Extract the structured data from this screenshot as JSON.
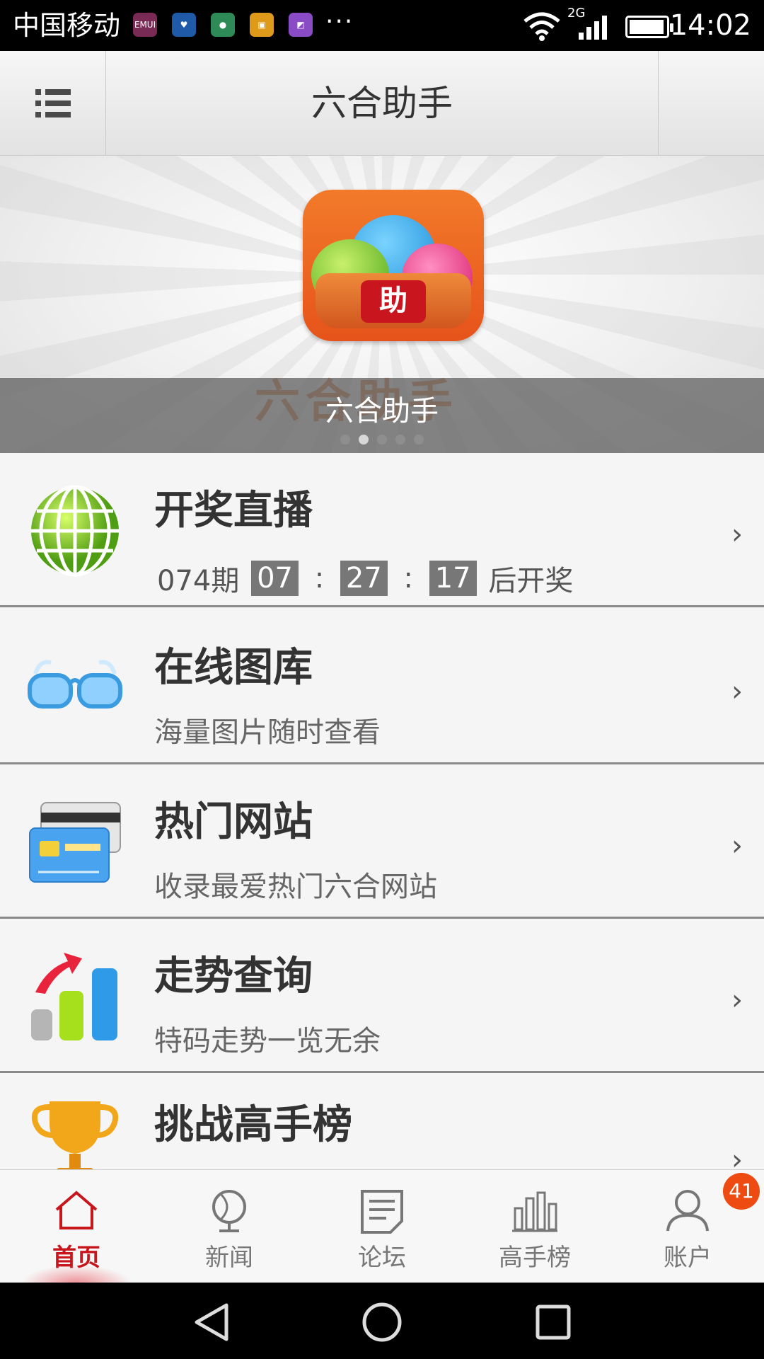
{
  "status_bar": {
    "carrier": "中国移动",
    "notification_icons": [
      "emui-icon",
      "health-icon",
      "message-icon",
      "wallet-icon",
      "gallery-icon"
    ],
    "overflow": "···",
    "network": "2G",
    "time": "14:02"
  },
  "header": {
    "title": "六合助手",
    "menu_icon": "list-menu-icon"
  },
  "banner": {
    "caption": "六合助手",
    "icon_badge": "助",
    "watermark": "六合助手",
    "pages": 5,
    "active_page": 2
  },
  "list": {
    "items": [
      {
        "title": "开奖直播",
        "icon": "globe-icon",
        "countdown": {
          "issue": "074期",
          "hours": "07",
          "minutes": "27",
          "seconds": "17",
          "suffix": "后开奖",
          "sep": ":"
        }
      },
      {
        "title": "在线图库",
        "subtitle": "海量图片随时查看",
        "icon": "glasses-icon"
      },
      {
        "title": "热门网站",
        "subtitle": "收录最爱热门六合网站",
        "icon": "card-icon"
      },
      {
        "title": "走势查询",
        "subtitle": "特码走势一览无余",
        "icon": "trend-chart-icon"
      },
      {
        "title": "挑战高手榜",
        "icon": "trophy-icon"
      }
    ],
    "arrow": "›"
  },
  "tabbar": {
    "tabs": [
      {
        "label": "首页",
        "icon": "home-icon",
        "active": true
      },
      {
        "label": "新闻",
        "icon": "globe-icon"
      },
      {
        "label": "论坛",
        "icon": "forum-icon"
      },
      {
        "label": "高手榜",
        "icon": "ranking-icon"
      },
      {
        "label": "账户",
        "icon": "account-icon",
        "badge": "41"
      }
    ]
  },
  "colors": {
    "accent": "#c8161d",
    "badge": "#ee4b12",
    "header_bg": "#ececec"
  }
}
